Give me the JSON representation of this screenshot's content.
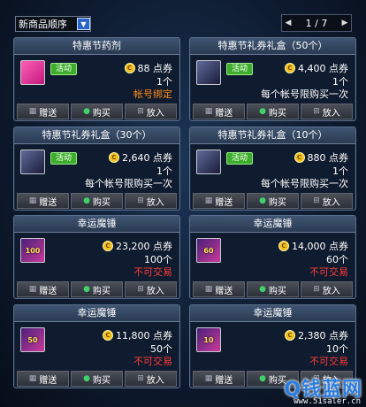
{
  "toolbar": {
    "sort_label": "新商品顺序",
    "dropdown_glyph": "▼",
    "prev_glyph": "◀",
    "next_glyph": "▶",
    "page_text": "1 / 7"
  },
  "buttons": {
    "gift": "赠送",
    "buy": "购买",
    "cart": "放入"
  },
  "items": [
    {
      "title": "特惠节药剂",
      "icon": "potion-icon",
      "icon_text": "",
      "hot": "活动",
      "price": "88 点券",
      "qty": "1个",
      "note": "帐号绑定",
      "note_color": "#ff8c1a"
    },
    {
      "title": "特惠节礼券礼盒（50个）",
      "icon": "gift-box-icon",
      "icon_text": "",
      "hot": "活动",
      "price": "4,400 点券",
      "qty": "1个",
      "note": "每个帐号限购买一次",
      "note_color": "#ffffff"
    },
    {
      "title": "特惠节礼券礼盒（30个）",
      "icon": "gift-box-icon",
      "icon_text": "",
      "hot": "活动",
      "price": "2,640 点券",
      "qty": "1个",
      "note": "每个帐号限购买一次",
      "note_color": "#ffffff"
    },
    {
      "title": "特惠节礼券礼盒（10个）",
      "icon": "gift-box-icon",
      "icon_text": "",
      "hot": "活动",
      "price": "880 点券",
      "qty": "1个",
      "note": "每个帐号限购买一次",
      "note_color": "#ffffff"
    },
    {
      "title": "幸运魔锤",
      "icon": "hammer-icon",
      "icon_text": "100",
      "hot": "",
      "price": "23,200 点券",
      "qty": "100个",
      "note": "不可交易",
      "note_color": "#ff3b3b"
    },
    {
      "title": "幸运魔锤",
      "icon": "hammer-icon",
      "icon_text": "60",
      "hot": "",
      "price": "14,000 点券",
      "qty": "60个",
      "note": "不可交易",
      "note_color": "#ff3b3b"
    },
    {
      "title": "幸运魔锤",
      "icon": "hammer-icon",
      "icon_text": "50",
      "hot": "",
      "price": "11,800 点券",
      "qty": "50个",
      "note": "不可交易",
      "note_color": "#ff3b3b"
    },
    {
      "title": "幸运魔锤",
      "icon": "hammer-icon",
      "icon_text": "10",
      "hot": "",
      "price": "2,380 点券",
      "qty": "10个",
      "note": "不可交易",
      "note_color": "#ff3b3b"
    }
  ],
  "watermark": {
    "brand": "Q钱蓝网",
    "url": "www.51saler.cn"
  }
}
